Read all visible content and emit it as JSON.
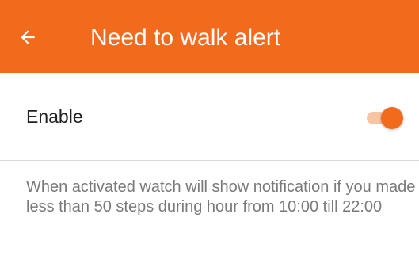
{
  "app_bar": {
    "title": "Need to walk alert",
    "back_icon": "arrow-left-icon",
    "background_color": "#f26b1d"
  },
  "setting": {
    "label": "Enable",
    "enabled": true,
    "accent_color": "#f26b1d"
  },
  "description": "When activated watch will show notification if you made less than 50 steps during hour from 10:00 till 22:00"
}
